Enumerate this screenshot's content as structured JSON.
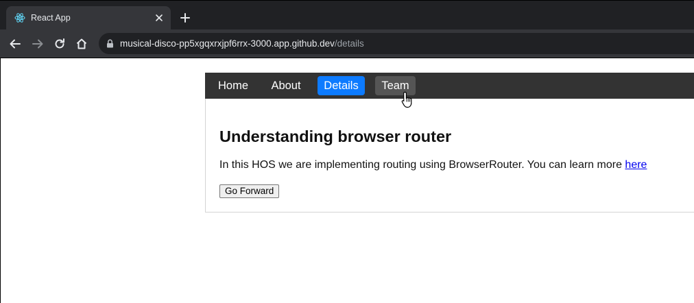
{
  "browser": {
    "tab": {
      "title": "React App"
    },
    "address_bar": {
      "host": "musical-disco-pp5xgqxrxjpf6rrx-3000.app.github.dev",
      "path": "/details"
    }
  },
  "navbar": {
    "items": [
      {
        "label": "Home",
        "active": false
      },
      {
        "label": "About",
        "active": false
      },
      {
        "label": "Details",
        "active": true
      },
      {
        "label": "Team",
        "hovered": true
      }
    ],
    "colors": {
      "background": "#333333",
      "active": "#0d7bff",
      "hover": "#555555"
    }
  },
  "content": {
    "heading": "Understanding browser router",
    "paragraph": "In this HOS we are implementing routing using BrowserRouter. You can learn more ",
    "link_text": "here",
    "button_label": "Go Forward"
  }
}
